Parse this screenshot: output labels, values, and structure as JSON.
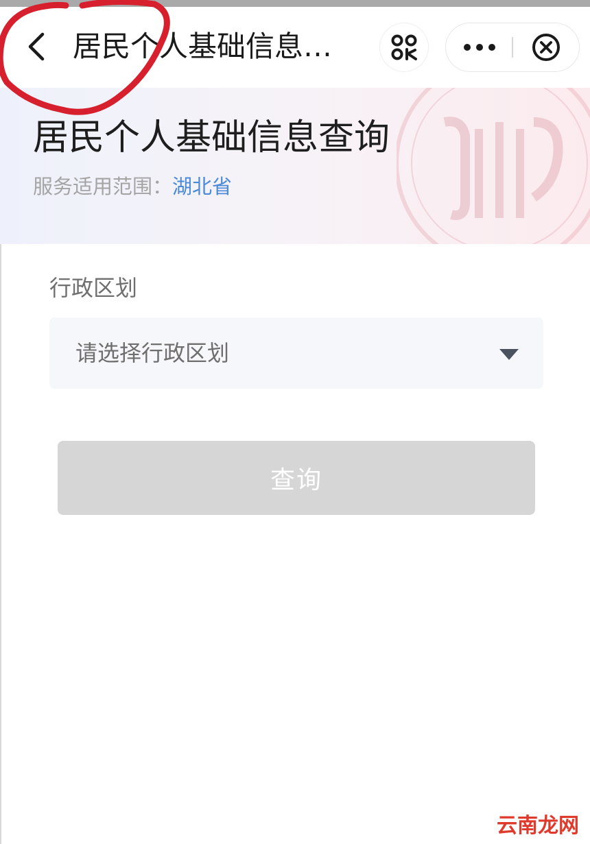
{
  "nav": {
    "title": "居民个人基础信息…",
    "back_icon": "chevron-left-icon",
    "scan_icon": "scan-qr-icon",
    "more_icon": "more-dots-icon",
    "close_icon": "close-circle-icon"
  },
  "header": {
    "title": "居民个人基础信息查询",
    "scope_label": "服务适用范围：",
    "scope_value": "湖北省"
  },
  "form": {
    "region_label": "行政区划",
    "region_placeholder": "请选择行政区划",
    "dropdown_icon": "caret-down-icon"
  },
  "actions": {
    "query_label": "查询"
  },
  "watermark": {
    "text": "云南龙网"
  },
  "colors": {
    "accent_link": "#4a8ad8",
    "button_disabled": "#d6d6d6",
    "annotation_red": "#d6202e"
  }
}
